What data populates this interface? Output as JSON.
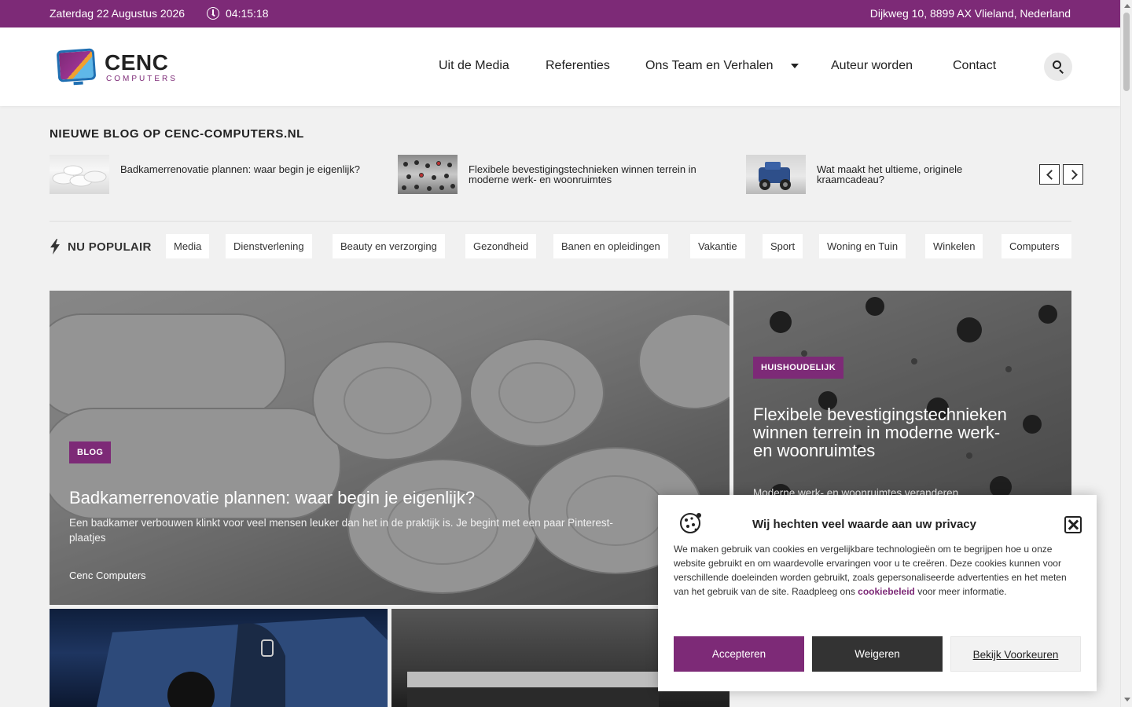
{
  "topbar": {
    "date": "Zaterdag 22 Augustus 2026",
    "time": "04:15:18",
    "address": "Dijkweg 10, 8899 AX Vlieland, Nederland",
    "bg_color": "#7d2a77"
  },
  "brand": {
    "name": "CENC",
    "tagline": "COMPUTERS"
  },
  "nav": {
    "items": [
      "Uit de Media",
      "Referenties",
      "Ons Team en Verhalen",
      "Auteur worden",
      "Contact"
    ]
  },
  "ticker": {
    "title": "NIEUWE BLOG OP CENC-COMPUTERS.NL",
    "items": [
      "Badkamerrenovatie plannen: waar begin je eigenlijk?",
      "Flexibele bevestigingstechnieken winnen terrein in moderne werk- en woonruimtes",
      "Wat maakt het ultieme, originele kraamcadeau?"
    ]
  },
  "popular": {
    "label": "NU POPULAIR",
    "tags": [
      "Media",
      "Dienstverlening",
      "Beauty en verzorging",
      "Gezondheid",
      "Banen en opleidingen",
      "Vakantie",
      "Sport",
      "Woning en Tuin",
      "Winkelen",
      "Computers"
    ]
  },
  "featured": {
    "main": {
      "badge": "BLOG",
      "title": "Badkamerrenovatie plannen: waar begin je eigenlijk?",
      "excerpt": "Een badkamer verbouwen klinkt voor veel mensen leuker dan het in de praktijk is. Je begint met een paar Pinterest-plaatjes",
      "author": "Cenc Computers"
    },
    "side": {
      "badge": "HUISHOUDELIJK",
      "title": "Flexibele bevestigingstechnieken winnen terrein in moderne werk- en woonruimtes",
      "excerpt": "Moderne werk- en woonruimtes veranderen"
    }
  },
  "cookie": {
    "title": "Wij hechten veel waarde aan uw privacy",
    "text_before": "We maken gebruik van cookies en vergelijkbare technologieën om te begrijpen hoe u onze website gebruikt en om waardevolle ervaringen voor u te creëren. Deze cookies kunnen voor verschillende doeleinden worden gebruikt, zoals gepersonaliseerde advertenties en het meten van het gebruik van de site. Raadpleeg ons ",
    "link": "cookiebeleid",
    "text_after": " voor meer informatie.",
    "accept": "Accepteren",
    "deny": "Weigeren",
    "prefs": "Bekijk Voorkeuren"
  },
  "icons": [
    "clock-icon",
    "search-icon",
    "bolt-icon",
    "cookie-icon",
    "close-icon",
    "chevron-left-icon",
    "chevron-right-icon"
  ]
}
